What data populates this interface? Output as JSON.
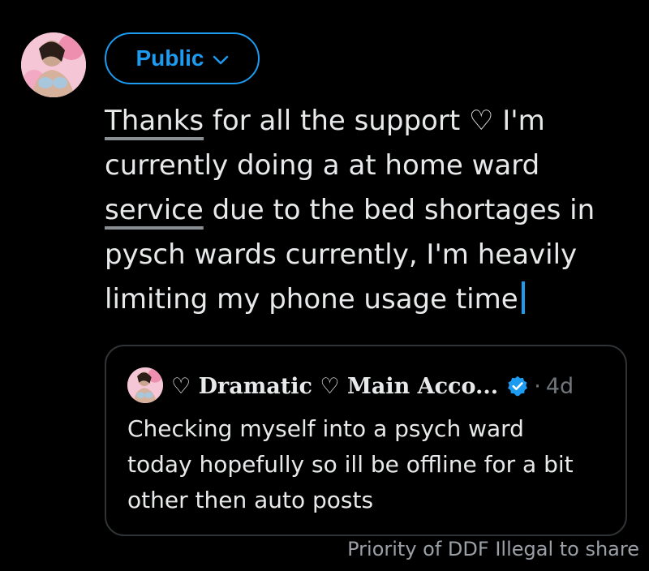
{
  "audience": {
    "label": "Public",
    "icon": "chevron-down-icon"
  },
  "composer": {
    "lines": [
      {
        "underlined": "Thanks",
        "rest": " for all the support ♡ I'm"
      },
      {
        "underlined": "",
        "rest": "currently doing a at home ward"
      },
      {
        "underlined": "service",
        "rest": " due to the bed shortages in"
      },
      {
        "underlined": "",
        "rest": "pysch wards currently, I'm heavily"
      },
      {
        "underlined": "",
        "rest": "limiting my phone usage time"
      }
    ]
  },
  "quoted_post": {
    "author": "♡ Dramatic ♡ Main Acco...",
    "verified_icon": "verified-badge-icon",
    "separator": "·",
    "age": "4d",
    "text_lines": [
      "Checking myself into a psych ward",
      "today hopefully so ill be offline for a bit",
      "other then auto posts"
    ]
  },
  "watermark": "Priority of DDF Illegal to share",
  "colors": {
    "accent": "#1d9bf0",
    "background": "#000000",
    "text": "#e7e9ea",
    "muted": "#71767b",
    "border": "#2f3336"
  }
}
